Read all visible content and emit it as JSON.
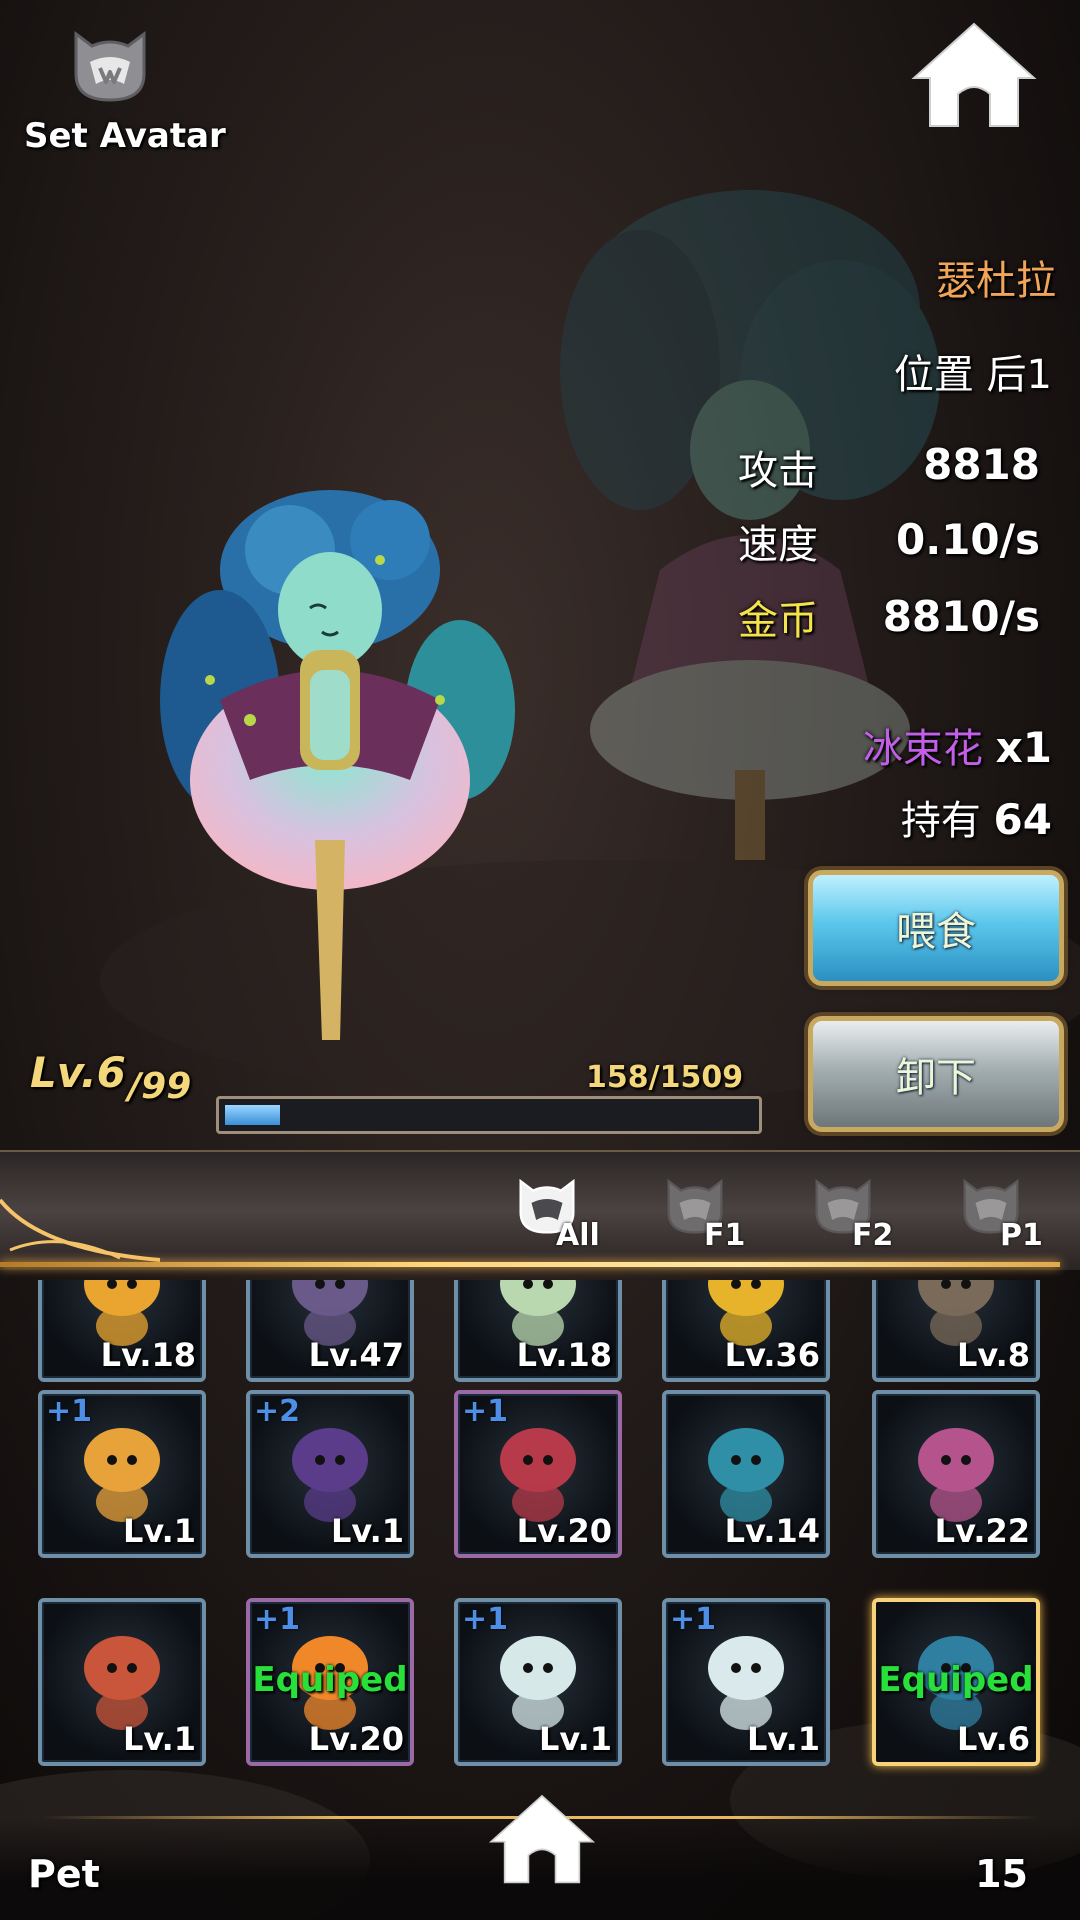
{
  "top": {
    "avatar_label": "Set Avatar"
  },
  "pet": {
    "name": "瑟杜拉",
    "position": "位置 后1",
    "attack_label": "攻击",
    "attack_value": "8818",
    "speed_label": "速度",
    "speed_value": "0.10/s",
    "gold_label": "金币",
    "gold_value": "8810/s",
    "food_name": "冰束花",
    "food_count": "x1",
    "hold_label": "持有",
    "hold_value": "64"
  },
  "buttons": {
    "feed": "喂食",
    "unequip": "卸下"
  },
  "level": {
    "current": "Lv.6",
    "max": "/99",
    "xp_text": "158/1509",
    "xp_fraction": 0.105
  },
  "filters": [
    {
      "label": "All"
    },
    {
      "label": "F1"
    },
    {
      "label": "F2"
    },
    {
      "label": "P1"
    }
  ],
  "grid": {
    "rows": [
      [
        {
          "lv": "Lv.18",
          "plus": "",
          "equip": "",
          "frame": "blue",
          "color": "#e9a52f"
        },
        {
          "lv": "Lv.47",
          "plus": "",
          "equip": "",
          "frame": "blue",
          "color": "#6a5a8a"
        },
        {
          "lv": "Lv.18",
          "plus": "",
          "equip": "",
          "frame": "blue",
          "color": "#b9d8b0"
        },
        {
          "lv": "Lv.36",
          "plus": "",
          "equip": "",
          "frame": "blue",
          "color": "#e6b32a"
        },
        {
          "lv": "Lv.8",
          "plus": "",
          "equip": "",
          "frame": "blue",
          "color": "#7a6a5a"
        }
      ],
      [
        {
          "lv": "Lv.1",
          "plus": "+1",
          "equip": "",
          "frame": "blue",
          "color": "#e8a23a"
        },
        {
          "lv": "Lv.1",
          "plus": "+2",
          "equip": "",
          "frame": "blue",
          "color": "#5a3c8a"
        },
        {
          "lv": "Lv.20",
          "plus": "+1",
          "equip": "",
          "frame": "purple",
          "color": "#b73a4a"
        },
        {
          "lv": "Lv.14",
          "plus": "",
          "equip": "",
          "frame": "blue",
          "color": "#2f8fa6"
        },
        {
          "lv": "Lv.22",
          "plus": "",
          "equip": "",
          "frame": "blue",
          "color": "#b5548c"
        }
      ],
      [
        {
          "lv": "Lv.1",
          "plus": "",
          "equip": "",
          "frame": "blue",
          "color": "#c9563a"
        },
        {
          "lv": "Lv.20",
          "plus": "+1",
          "equip": "Equiped",
          "frame": "purple",
          "color": "#f0882a"
        },
        {
          "lv": "Lv.1",
          "plus": "+1",
          "equip": "",
          "frame": "blue",
          "color": "#d7e8e8"
        },
        {
          "lv": "Lv.1",
          "plus": "+1",
          "equip": "",
          "frame": "blue",
          "color": "#d9e9ec"
        },
        {
          "lv": "Lv.6",
          "plus": "",
          "equip": "Equiped",
          "frame": "gold",
          "color": "#2f7fa0"
        }
      ]
    ]
  },
  "bottom": {
    "label": "Pet",
    "count": "15"
  }
}
